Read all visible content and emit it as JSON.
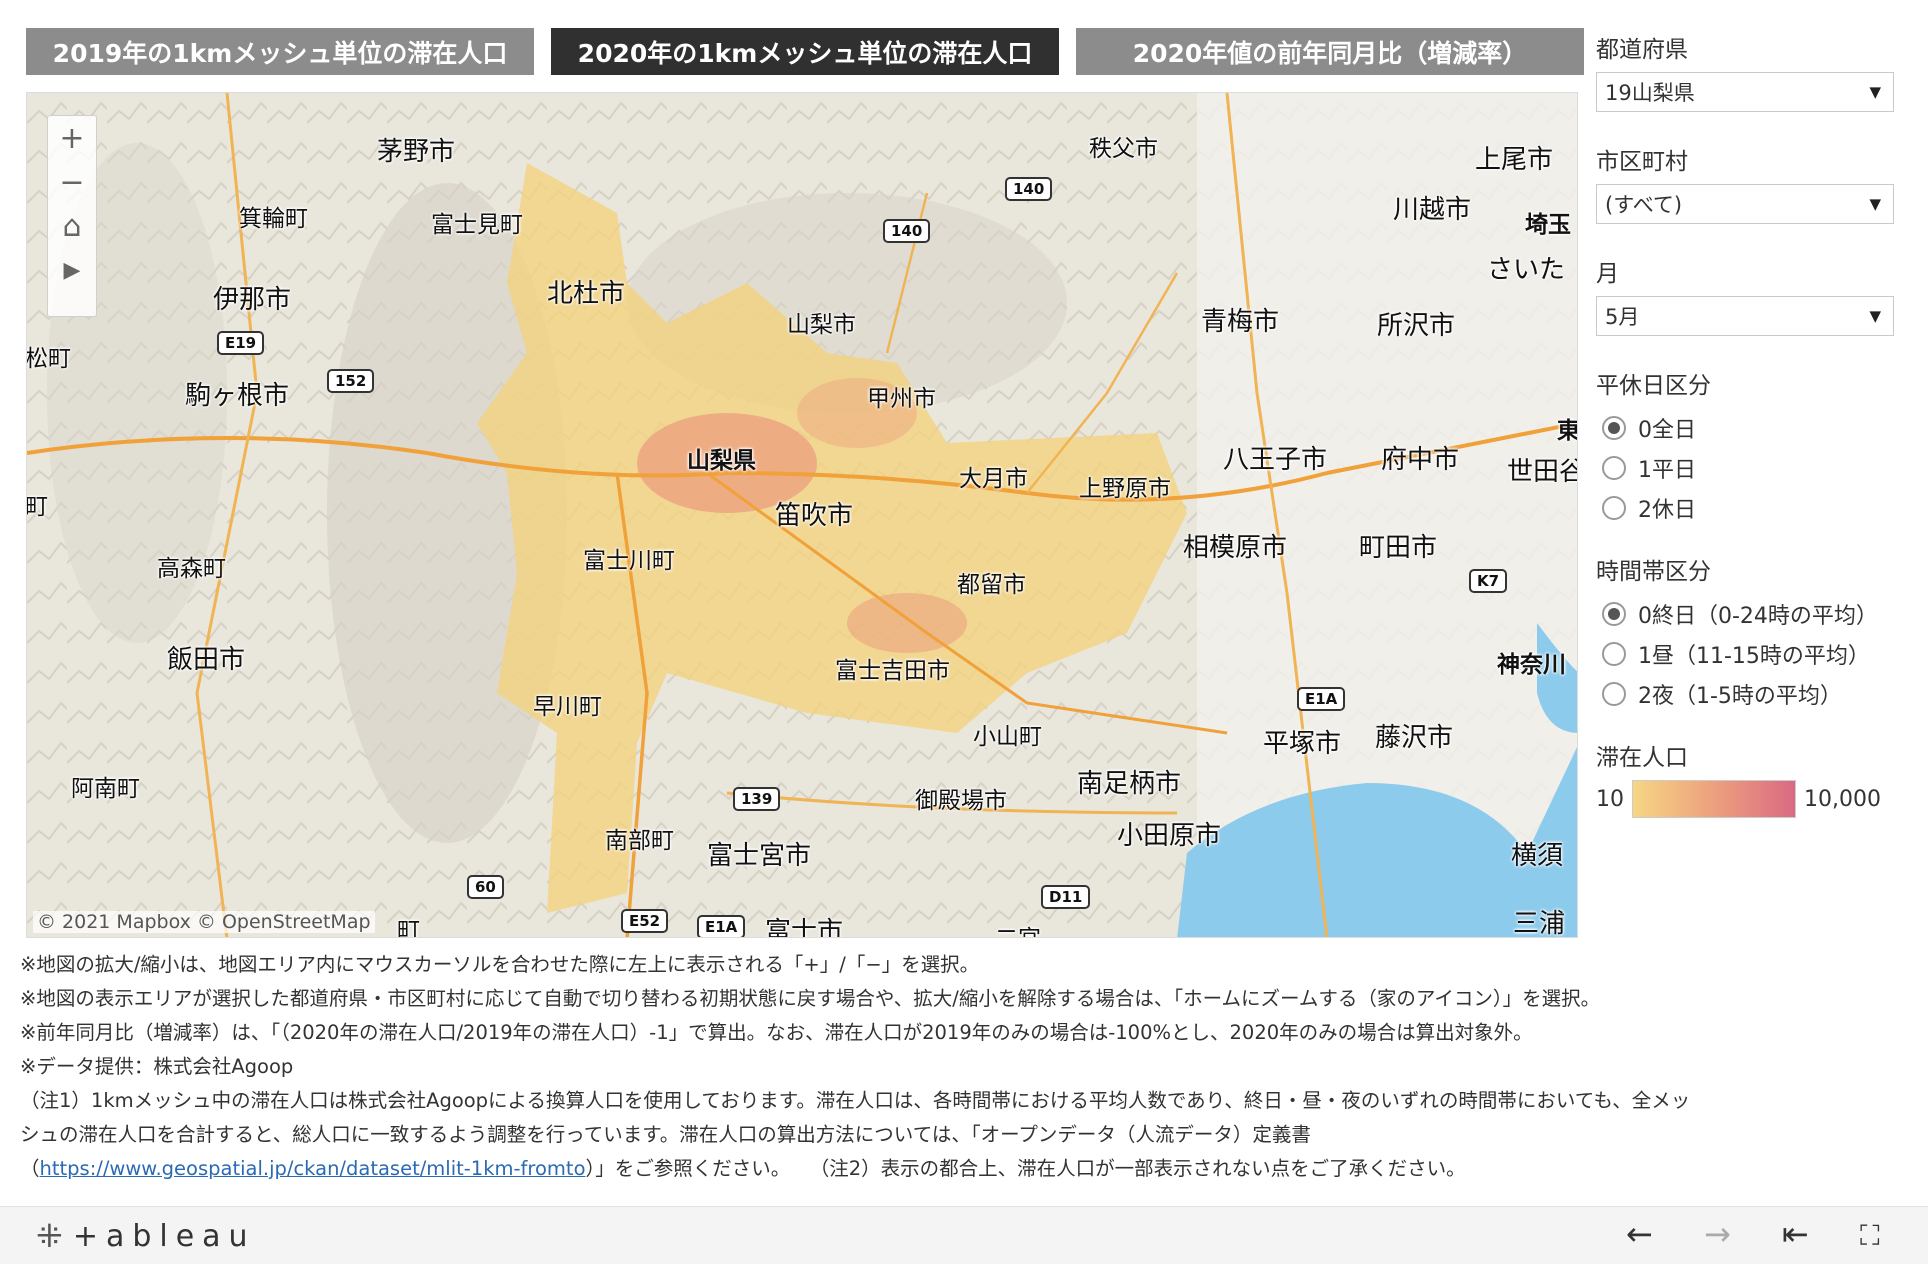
{
  "tabs": [
    {
      "label": "2019年の1kmメッシュ単位の滞在人口",
      "active": false
    },
    {
      "label": "2020年の1kmメッシュ単位の滞在人口",
      "active": true
    },
    {
      "label": "2020年値の前年同月比（増減率）",
      "active": false
    }
  ],
  "map": {
    "attribution": "© 2021 Mapbox  © OpenStreetMap",
    "labels": {
      "chino": "茅野市",
      "chichibu": "秩父市",
      "ageo": "上尾市",
      "minowa": "箕輪町",
      "fujimi": "富士見町",
      "kawagoe": "川越市",
      "saitama_pref": "埼玉",
      "saitama": "さいた",
      "ina": "伊那市",
      "hokuto": "北杜市",
      "yamanashi_city": "山梨市",
      "ome": "青梅市",
      "tokorozawa": "所沢市",
      "matsu": "松町",
      "komagane": "駒ヶ根市",
      "koshu": "甲州市",
      "yamanashi_pref": "山梨県",
      "otsuki": "大月市",
      "hachioji": "八王子市",
      "fuchu": "府中市",
      "setagaya": "世田谷",
      "uenohara": "上野原市",
      "fuefuki": "笛吹市",
      "takamori": "高森町",
      "fujikawa": "富士川町",
      "sagamihara": "相模原市",
      "machida": "町田市",
      "tsuru": "都留市",
      "iida": "飯田市",
      "fujiyoshida": "富士吉田市",
      "kanagawa": "神奈川",
      "hayakawa": "早川町",
      "oyama": "小山町",
      "hiratsuka": "平塚市",
      "fujisawa": "藤沢市",
      "anan": "阿南町",
      "minamiashigara": "南足柄市",
      "gotemba": "御殿場市",
      "nanbu": "南部町",
      "odawara": "小田原市",
      "fujinomiya": "富士宮市",
      "yokosuka": "横須",
      "fuji": "富士市",
      "miura": "三浦",
      "higashi": "東",
      "machi_left": "町",
      "machi_bottom": "町",
      "ninomiya": "二宮"
    },
    "shields": {
      "r140a": "140",
      "r140b": "140",
      "e19": "E19",
      "r152": "152",
      "k7": "K7",
      "e1a_right": "E1A",
      "r139": "139",
      "r60": "60",
      "e52": "E52",
      "e1a_bottom": "E1A",
      "d11": "D11"
    },
    "controls": {
      "zoom_in": "+",
      "zoom_out": "−",
      "home": "⌂",
      "play": "▶"
    }
  },
  "filters": {
    "prefecture": {
      "label": "都道府県",
      "value": "19山梨県"
    },
    "city": {
      "label": "市区町村",
      "value": "(すべて)"
    },
    "month": {
      "label": "月",
      "value": "5月"
    },
    "daytype": {
      "label": "平休日区分",
      "options": [
        "0全日",
        "1平日",
        "2休日"
      ],
      "selected": 0
    },
    "timeslot": {
      "label": "時間帯区分",
      "options": [
        "0終日（0-24時の平均）",
        "1昼（11-15時の平均）",
        "2夜（1-5時の平均）"
      ],
      "selected": 0
    }
  },
  "legend": {
    "title": "滞在人口",
    "min": "10",
    "max": "10,000",
    "colors": [
      "#f6d684",
      "#d96a83"
    ]
  },
  "notes": {
    "line1": "※地図の拡大/縮小は、地図エリア内にマウスカーソルを合わせた際に左上に表示される「+」/「−」を選択。",
    "line2": "※地図の表示エリアが選択した都道府県・市区町村に応じて自動で切り替わる初期状態に戻す場合や、拡大/縮小を解除する場合は、「ホームにズームする（家のアイコン）」を選択。",
    "line3": "※前年同月比（増減率）は、「（2020年の滞在人口/2019年の滞在人口）-1」で算出。なお、滞在人口が2019年のみの場合は-100%とし、2020年のみの場合は算出対象外。",
    "line4": "※データ提供：株式会社Agoop",
    "line5": "（注1）1kmメッシュ中の滞在人口は株式会社Agoopによる換算人口を使用しております。滞在人口は、各時間帯における平均人数であり、終日・昼・夜のいずれの時間帯においても、全メッ",
    "line6": "シュの滞在人口を合計すると、総人口に一致するよう調整を行っています。滞在人口の算出方法については、「オープンデータ（人流データ）定義書",
    "line7_pre": "（",
    "link": "https://www.geospatial.jp/ckan/dataset/mlit-1km-fromto",
    "line7_post": "）」をご参照ください。　　（注2）表示の都合上、滞在人口が一部表示されない点をご了承ください。"
  },
  "footer": {
    "logo": "+ableau",
    "logo_mark": "⁜",
    "back": "←",
    "forward": "→",
    "reset": "⇤",
    "fullscreen": "⛶"
  }
}
